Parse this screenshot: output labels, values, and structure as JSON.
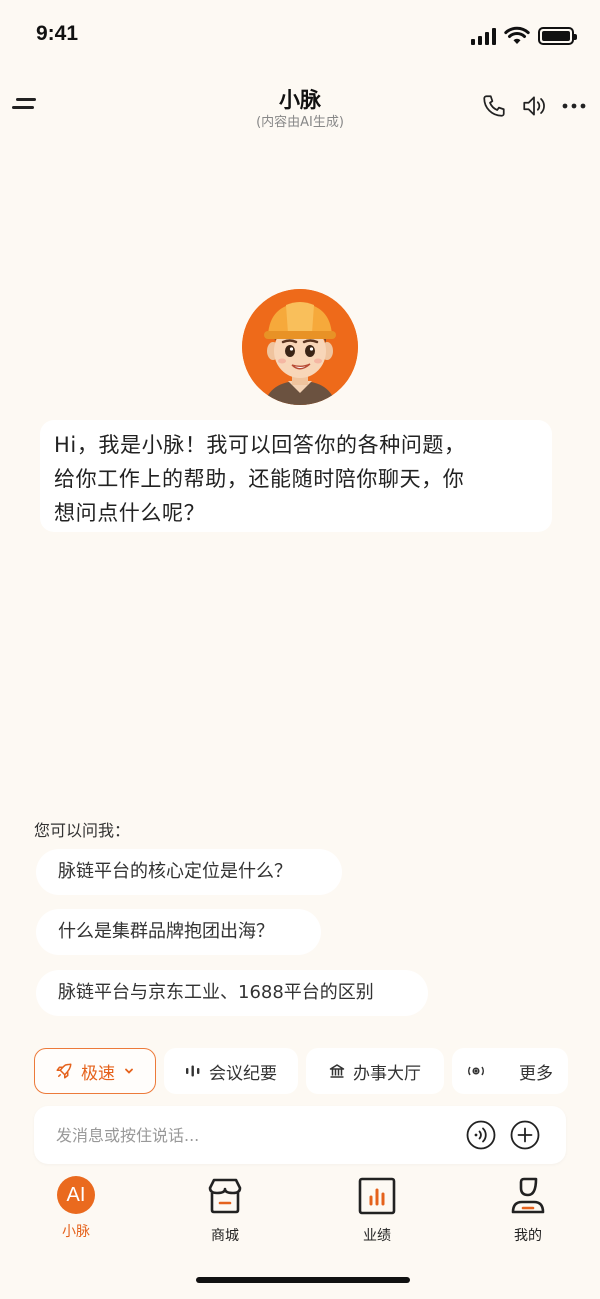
{
  "status_bar": {
    "time": "9:41"
  },
  "nav": {
    "title": "小脉",
    "subtitle": "(内容由AI生成)"
  },
  "greeting": {
    "line1": "Hi，我是小脉！我可以回答你的各种问题，",
    "line2": "给你工作上的帮助，还能随时陪你聊天，你",
    "line3": "想问点什么呢？"
  },
  "suggestions": {
    "label": "您可以问我：",
    "items": [
      "脉链平台的核心定位是什么？",
      "什么是集群品牌抱团出海？",
      "脉链平台与京东工业、1688平台的区别"
    ]
  },
  "tools": {
    "speed": "极速",
    "meeting": "会议纪要",
    "service": "办事大厅",
    "more": "更多"
  },
  "input": {
    "placeholder": "发消息或按住说话..."
  },
  "tabs": {
    "ai_icon_text": "AI",
    "ai": "小脉",
    "mall": "商城",
    "performance": "业绩",
    "mine": "我的"
  },
  "colors": {
    "accent": "#e5621c",
    "background": "#fdf9f3"
  }
}
